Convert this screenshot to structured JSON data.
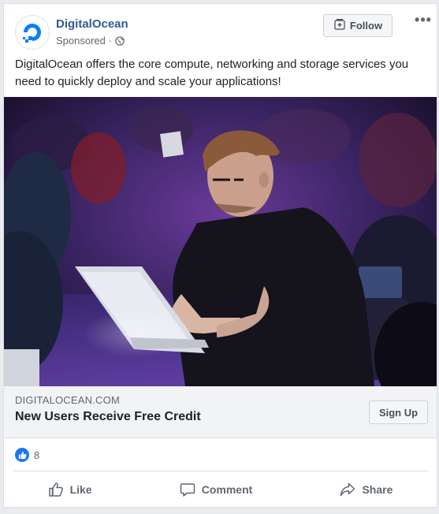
{
  "post": {
    "page_name": "DigitalOcean",
    "sponsored_label": "Sponsored",
    "separator": "·",
    "privacy_icon": "globe-icon",
    "follow_label": "Follow",
    "more_label": "•••",
    "text": "DigitalOcean offers the core compute, networking and storage services you need to quickly deploy and scale your applications!"
  },
  "link_preview": {
    "domain": "DIGITALOCEAN.COM",
    "title": "New Users Receive Free Credit",
    "cta_label": "Sign Up"
  },
  "reactions": {
    "icon": "like-icon",
    "count": "8"
  },
  "actions": [
    {
      "label": "Like",
      "icon": "thumbs-up-icon"
    },
    {
      "label": "Comment",
      "icon": "comment-icon"
    },
    {
      "label": "Share",
      "icon": "share-icon"
    }
  ],
  "colors": {
    "brand": "#0080ff",
    "link_name": "#365899",
    "reaction_blue": "#1877f2"
  }
}
